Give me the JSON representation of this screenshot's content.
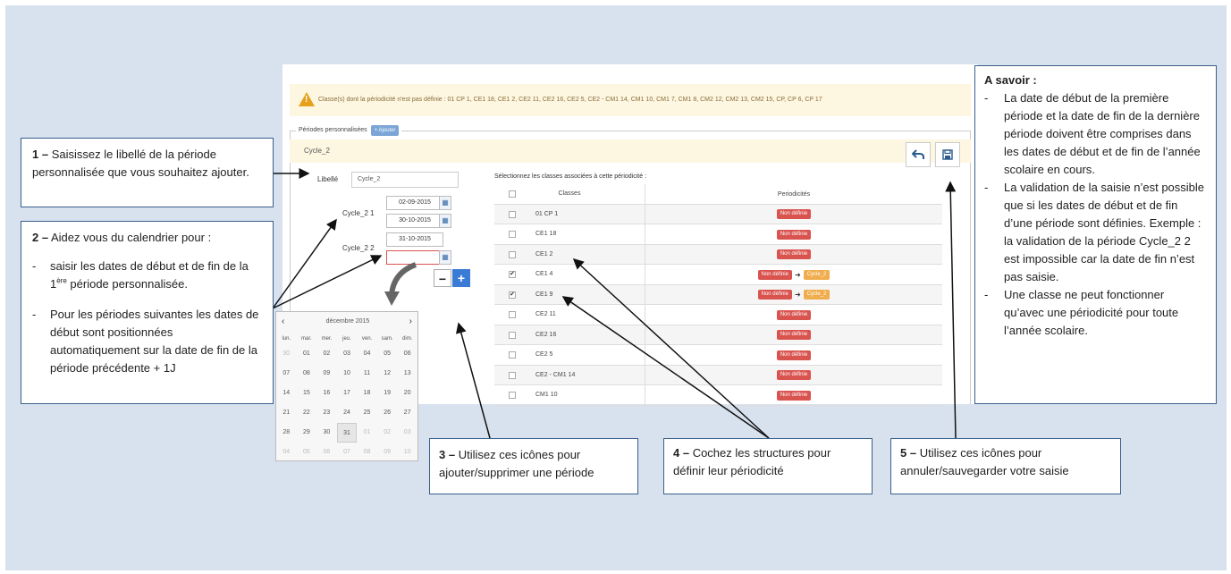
{
  "warning": {
    "icon": "warning-icon",
    "text": "Classe(s) dont la périodicité n'est pas définie : 01 CP 1, CE1 18, CE1 2, CE2 11, CE2 16, CE2 5, CE2 - CM1 14, CM1 10, CM1 7, CM1 8, CM2 12, CM2 13, CM2 15, CP, CP 6, CP 17"
  },
  "periods": {
    "legend": "Périodes personnalisées",
    "add_label": "+ Ajouter",
    "cycle_title": "Cycle_2",
    "undo_icon": "undo-icon",
    "save_icon": "save-icon",
    "libelle_label": "Libellé",
    "libelle_value": "Cycle_2",
    "sub1_label": "Cycle_2 1",
    "sub1_start": "02-09-2015",
    "sub1_end": "30-10-2015",
    "sub2_label": "Cycle_2 2",
    "sub2_start": "31-10-2015",
    "sub2_end": "",
    "minus_label": "−",
    "plus_label": "+"
  },
  "classes_table": {
    "title": "Sélectionnez les classes associées à cette périodicité :",
    "col_classes": "Classes",
    "col_periodicites": "Periodicités",
    "rows": [
      {
        "name": "01 CP 1",
        "checked": "",
        "status": "Non définie",
        "target": ""
      },
      {
        "name": "CE1 18",
        "checked": "",
        "status": "Non définie",
        "target": ""
      },
      {
        "name": "CE1 2",
        "checked": "",
        "status": "Non définie",
        "target": ""
      },
      {
        "name": "CE1 4",
        "checked": "✔",
        "status": "Non définie",
        "target": "Cycle_2"
      },
      {
        "name": "CE1 9",
        "checked": "✔",
        "status": "Non définie",
        "target": "Cycle_2"
      },
      {
        "name": "CE2 11",
        "checked": "",
        "status": "Non définie",
        "target": ""
      },
      {
        "name": "CE2 16",
        "checked": "",
        "status": "Non définie",
        "target": ""
      },
      {
        "name": "CE2 5",
        "checked": "",
        "status": "Non définie",
        "target": ""
      },
      {
        "name": "CE2 - CM1 14",
        "checked": "",
        "status": "Non définie",
        "target": ""
      },
      {
        "name": "CM1 10",
        "checked": "",
        "status": "Non définie",
        "target": ""
      }
    ]
  },
  "calendar": {
    "month": "décembre 2015",
    "prev": "‹",
    "next": "›",
    "weekdays": [
      "lun.",
      "mar.",
      "mer.",
      "jeu.",
      "ven.",
      "sam.",
      "dim."
    ],
    "days": [
      "30",
      "01",
      "02",
      "03",
      "04",
      "05",
      "06",
      "07",
      "08",
      "09",
      "10",
      "11",
      "12",
      "13",
      "14",
      "15",
      "16",
      "17",
      "18",
      "19",
      "20",
      "21",
      "22",
      "23",
      "24",
      "25",
      "26",
      "27",
      "28",
      "29",
      "30",
      "31",
      "01",
      "02",
      "03",
      "04",
      "05",
      "06",
      "07",
      "08",
      "09",
      "10"
    ]
  },
  "callouts": {
    "c1": {
      "num": "1 –",
      "text": " Saisissez le libellé de la période personnalisée que vous souhaitez ajouter."
    },
    "c2": {
      "num": "2 –",
      "intro": " Aidez vous du calendrier  pour :",
      "b1_pre": "saisir les dates de début et de fin de la 1",
      "b1_sup": "ère",
      "b1_post": " période personnalisée.",
      "b2": "Pour les périodes suivantes les dates de début sont positionnées automatiquement sur la date de fin de la période précédente + 1J"
    },
    "c3": {
      "num": "3 –",
      "text": " Utilisez ces icônes pour ajouter/supprimer une période"
    },
    "c4": {
      "num": "4 –",
      "text": " Cochez les structures pour définir leur périodicité"
    },
    "c5": {
      "num": "5 –",
      "text": " Utilisez ces  icônes pour annuler/sauvegarder votre saisie"
    },
    "savoir": {
      "title": "A savoir :",
      "items": [
        "La date de début de la première période et la date de fin de la dernière période doivent être comprises dans les dates de début et de fin de l’année scolaire en cours.",
        "La validation de la saisie n’est possible que si les dates de début et de fin d’une période sont définies. Exemple : la validation de la période Cycle_2 2 est impossible car la date de fin n’est pas saisie.",
        "Une classe ne peut fonctionner qu’avec une périodicité pour toute l’année scolaire."
      ]
    }
  }
}
